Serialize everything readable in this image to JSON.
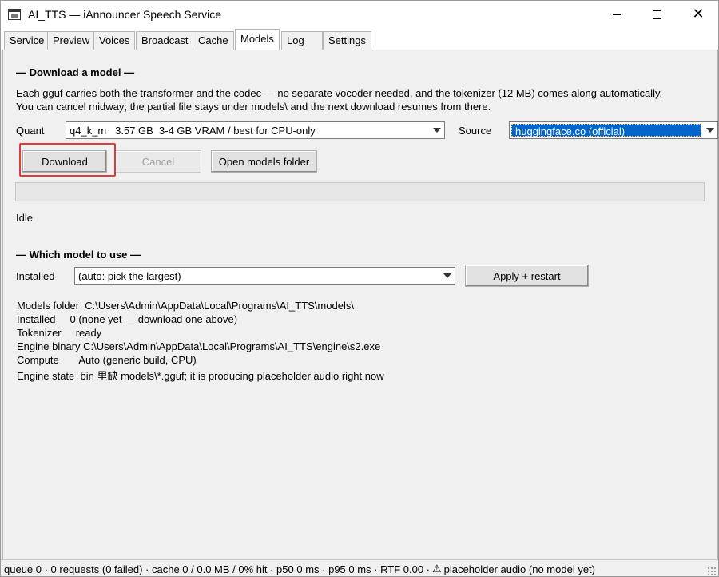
{
  "window": {
    "title": "AI_TTS — iAnnouncer Speech Service",
    "minimize_icon": "minimize-icon",
    "maximize_icon": "maximize-icon",
    "close_glyph": "✕"
  },
  "tabs": [
    {
      "label": "Service"
    },
    {
      "label": "Preview"
    },
    {
      "label": "Voices"
    },
    {
      "label": "Broadcast"
    },
    {
      "label": "Cache"
    },
    {
      "label": "Models",
      "active": true
    },
    {
      "label": "Log"
    },
    {
      "label": "Settings"
    }
  ],
  "download": {
    "section_title": "— Download a model —",
    "desc_line1": "Each gguf carries both the transformer and the codec — no separate vocoder needed, and the tokenizer (12 MB) comes along automatically.",
    "desc_line2": "You can cancel midway; the partial file stays under models\\ and the next download resumes from there.",
    "quant_label": "Quant",
    "quant_value": "q4_k_m   3.57 GB  3-4 GB VRAM / best for CPU-only",
    "source_label": "Source",
    "source_value": "huggingface.co (official)",
    "download_button": "Download",
    "cancel_button": "Cancel",
    "open_folder_button": "Open models folder",
    "progress": 0,
    "status": "Idle"
  },
  "use": {
    "section_title": "— Which model to use —",
    "installed_label": "Installed",
    "installed_value": "(auto: pick the largest)",
    "apply_button": "Apply + restart"
  },
  "info": [
    "Models folder  C:\\Users\\Admin\\AppData\\Local\\Programs\\AI_TTS\\models\\",
    "Installed     0 (none yet — download one above)",
    "Tokenizer     ready",
    "Engine binary C:\\Users\\Admin\\AppData\\Local\\Programs\\AI_TTS\\engine\\s2.exe",
    "Compute       Auto (generic build, CPU)",
    "Engine state  bin 里缺 models\\*.gguf; it is producing placeholder audio right now"
  ],
  "statusbar": {
    "text_before_icon": "queue 0 · 0 requests (0 failed) · cache 0 / 0.0 MB / 0% hit · p50 0 ms · p95 0 ms · RTF 0.00 ·",
    "warning_icon": "⚠",
    "text_after_icon": "placeholder audio (no model yet)"
  },
  "colors": {
    "highlight": "#e53935",
    "selection": "#0066cc"
  }
}
